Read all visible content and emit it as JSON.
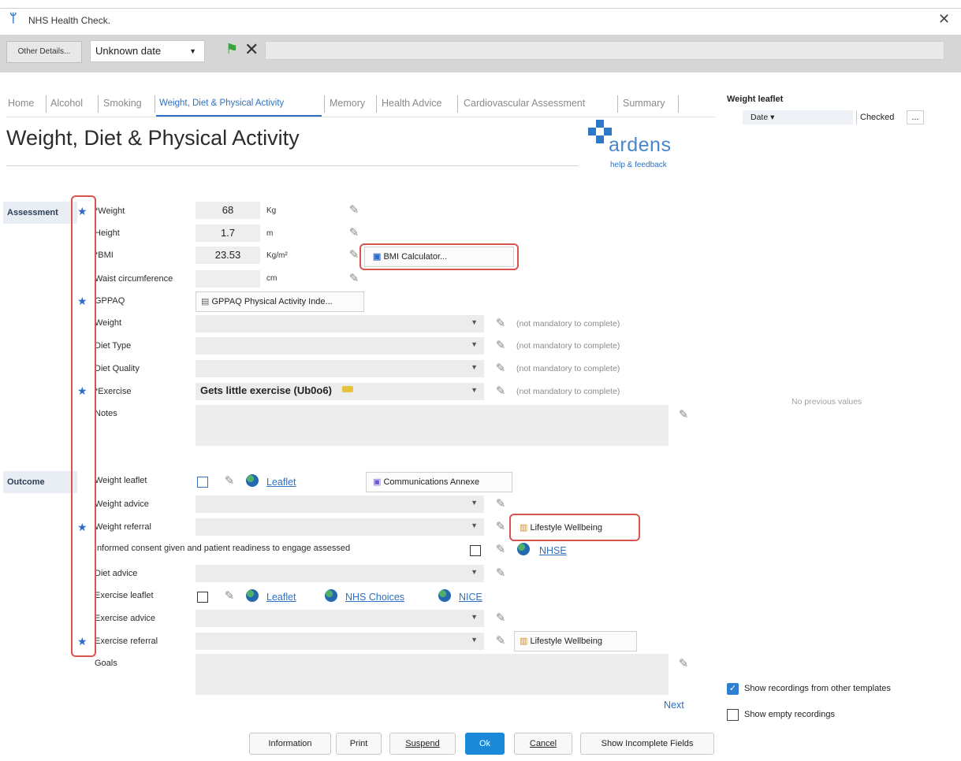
{
  "window": {
    "title": "NHS Health Check.",
    "close": "✕"
  },
  "toolbar": {
    "other_details": "Other Details...",
    "date_value": "Unknown date",
    "date_chevron": "▼",
    "flag_icon": "⚑",
    "x_icon": "✕"
  },
  "tabs": [
    {
      "label": "Home"
    },
    {
      "label": "Alcohol"
    },
    {
      "label": "Smoking"
    },
    {
      "label": "Weight, Diet & Physical Activity"
    },
    {
      "label": "Memory"
    },
    {
      "label": "Health Advice"
    },
    {
      "label": "Cardiovascular Assessment"
    },
    {
      "label": "Summary"
    }
  ],
  "page_title": "Weight, Diet & Physical Activity",
  "logo": {
    "name": "ardens",
    "help": "help & feedback"
  },
  "sections": {
    "assessment": "Assessment",
    "outcome": "Outcome"
  },
  "fields": {
    "weight": {
      "label": "*Weight",
      "value": "68",
      "unit": "Kg"
    },
    "height": {
      "label": "Height",
      "value": "1.7",
      "unit": "m"
    },
    "bmi": {
      "label": "*BMI",
      "value": "23.53",
      "unit": "Kg/m²",
      "calc_button": "BMI Calculator..."
    },
    "waist": {
      "label": "Waist circumference",
      "value": "",
      "unit": "cm"
    },
    "gppaq": {
      "label": "GPPAQ",
      "button": "GPPAQ Physical Activity Inde..."
    },
    "weight_dd": {
      "label": "Weight",
      "value": "",
      "note": "(not mandatory to complete)"
    },
    "diet_type": {
      "label": "Diet Type",
      "value": "",
      "note": "(not mandatory to complete)"
    },
    "diet_quality": {
      "label": "Diet Quality",
      "value": "",
      "note": "(not mandatory to complete)"
    },
    "exercise": {
      "label": "*Exercise",
      "value": "Gets little exercise (Ub0o6)",
      "note": "(not mandatory to complete)"
    },
    "notes": {
      "label": "Notes"
    },
    "weight_leaflet": {
      "label": "Weight leaflet",
      "link": "Leaflet",
      "annex_button": "Communications Annexe"
    },
    "weight_advice": {
      "label": "Weight advice"
    },
    "weight_referral": {
      "label": "Weight referral",
      "button": "Lifestyle Wellbeing"
    },
    "informed_consent": {
      "label": "Informed consent given and patient readiness to engage assessed",
      "link": "NHSE"
    },
    "diet_advice": {
      "label": "Diet advice"
    },
    "exercise_leaflet": {
      "label": "Exercise leaflet",
      "link1": "Leaflet",
      "link2": "NHS Choices",
      "link3": "NICE"
    },
    "exercise_advice": {
      "label": "Exercise advice"
    },
    "exercise_referral": {
      "label": "Exercise referral",
      "button": "Lifestyle Wellbeing"
    },
    "goals": {
      "label": "Goals"
    }
  },
  "next_link": "Next",
  "right_panel": {
    "title": "Weight leaflet",
    "col_date": "Date",
    "col_date_chevron": "▾",
    "col_checked": "Checked",
    "col_more": "...",
    "empty": "No previous values",
    "show_other": {
      "label": "Show recordings from other templates",
      "checked": true
    },
    "show_empty": {
      "label": "Show empty recordings",
      "checked": false
    }
  },
  "bottom_buttons": {
    "information": "Information",
    "print": "Print",
    "suspend": "Suspend",
    "ok": "Ok",
    "cancel": "Cancel",
    "show_incomplete": "Show Incomplete Fields"
  },
  "icons": {
    "pencil": "✎",
    "star": "★",
    "chevron": "▼"
  },
  "colors": {
    "accent": "#2f70c2",
    "ok_button": "#1a8ad8",
    "highlight": "#d9534f"
  }
}
